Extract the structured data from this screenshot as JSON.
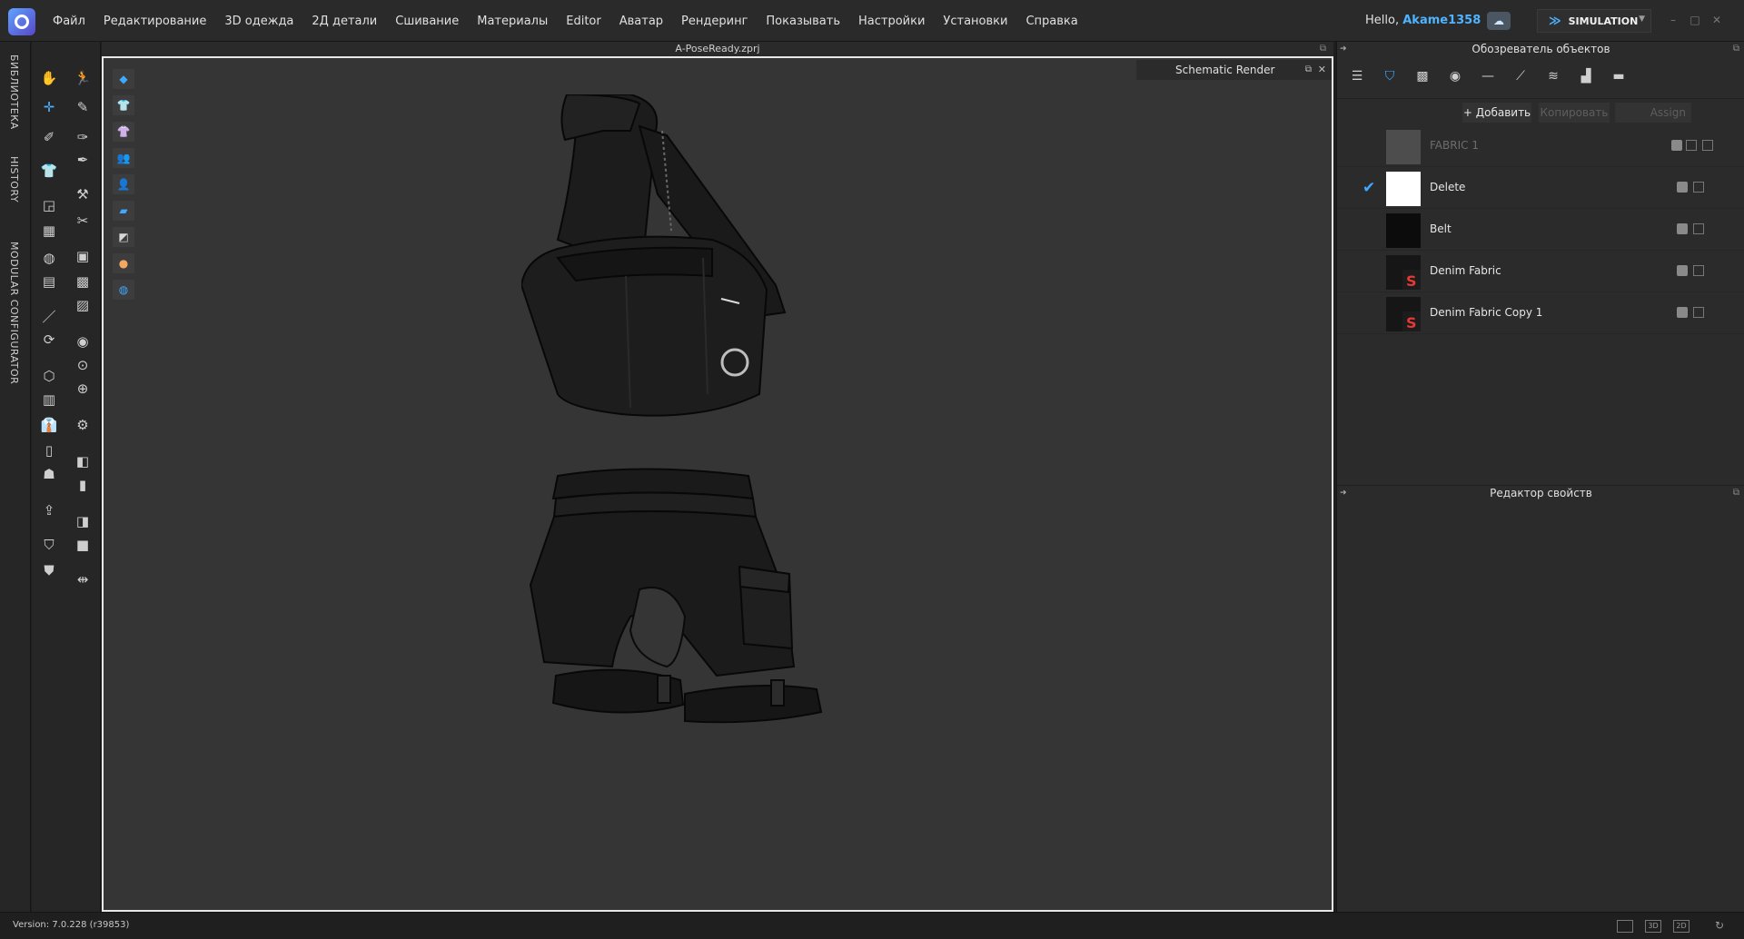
{
  "menu": [
    "Файл",
    "Редактирование",
    "3D одежда",
    "2Д детали",
    "Сшивание",
    "Материалы",
    "Editor",
    "Аватар",
    "Рендеринг",
    "Показывать",
    "Настройки",
    "Установки",
    "Справка"
  ],
  "header": {
    "greeting": "Hello,",
    "username": "Akame1358",
    "mode": "SIMULATION"
  },
  "left_tabs": [
    "БИБЛИОТЕКА",
    "HISTORY",
    "MODULAR CONFIGURATOR"
  ],
  "viewport": {
    "file_title": "A-PoseReady.zprj",
    "render_panel_title": "Schematic Render"
  },
  "object_browser": {
    "title": "Обозреватель объектов",
    "add_label": "+ Добавить",
    "copy_label": "Копировать",
    "assign_label": "Assign",
    "materials": [
      {
        "name": "FABRIC 1",
        "swatch": "#4d4d4e",
        "dim": true,
        "checked": false
      },
      {
        "name": "Delete",
        "swatch": "#ffffff",
        "dim": false,
        "checked": true
      },
      {
        "name": "Belt",
        "swatch": "#0c0c0c",
        "dim": false,
        "checked": false
      },
      {
        "name": "Denim Fabric",
        "swatch": "#161616",
        "dim": false,
        "checked": false,
        "badge": true
      },
      {
        "name": "Denim Fabric Copy 1",
        "swatch": "#161616",
        "dim": false,
        "checked": false,
        "badge": true
      }
    ]
  },
  "property_editor": {
    "title": "Редактор свойств"
  },
  "status": {
    "version": "Version: 7.0.228 (r39853)",
    "view_3d": "3D",
    "view_2d": "2D"
  },
  "colors": {
    "accent": "#3fa8ff",
    "username": "#4fb3ff",
    "viewport_bg": "#353536"
  }
}
